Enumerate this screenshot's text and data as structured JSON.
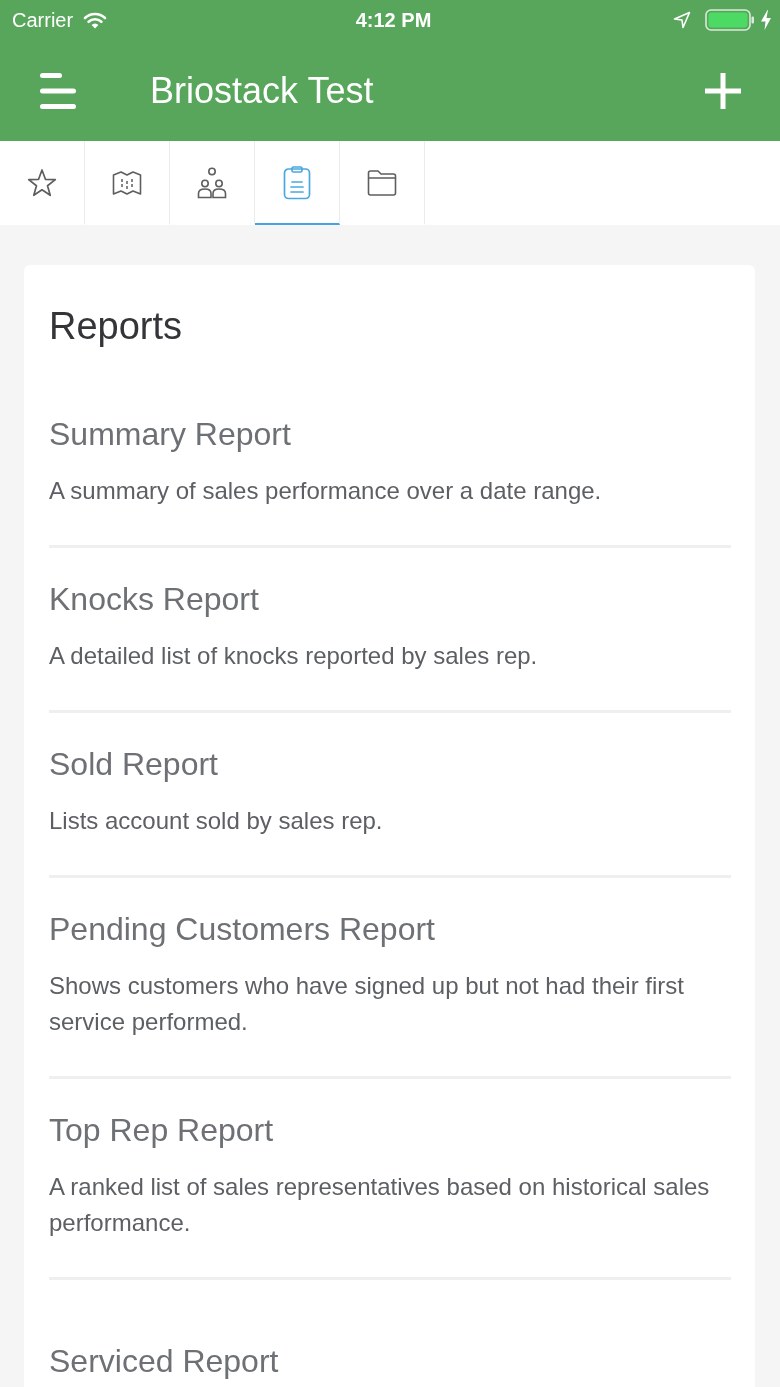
{
  "status_bar": {
    "carrier": "Carrier",
    "time": "4:12 PM"
  },
  "app_bar": {
    "title": "Briostack Test"
  },
  "tabs": [
    {
      "kind": "star",
      "selected": false
    },
    {
      "kind": "map",
      "selected": false
    },
    {
      "kind": "people",
      "selected": false
    },
    {
      "kind": "clipboard",
      "selected": true
    },
    {
      "kind": "folder",
      "selected": false
    }
  ],
  "card": {
    "title": "Reports",
    "reports": [
      {
        "title": "Summary Report",
        "description": "A summary of sales performance over a date range."
      },
      {
        "title": "Knocks Report",
        "description": "A detailed list of knocks reported by sales rep."
      },
      {
        "title": "Sold Report",
        "description": "Lists account sold by sales rep."
      },
      {
        "title": "Pending Customers Report",
        "description": "Shows customers who have signed up but not had their first service performed."
      },
      {
        "title": "Top Rep Report",
        "description": "A ranked list of sales representatives based on historical sales performance."
      },
      {
        "title": "Serviced Report"
      }
    ]
  }
}
